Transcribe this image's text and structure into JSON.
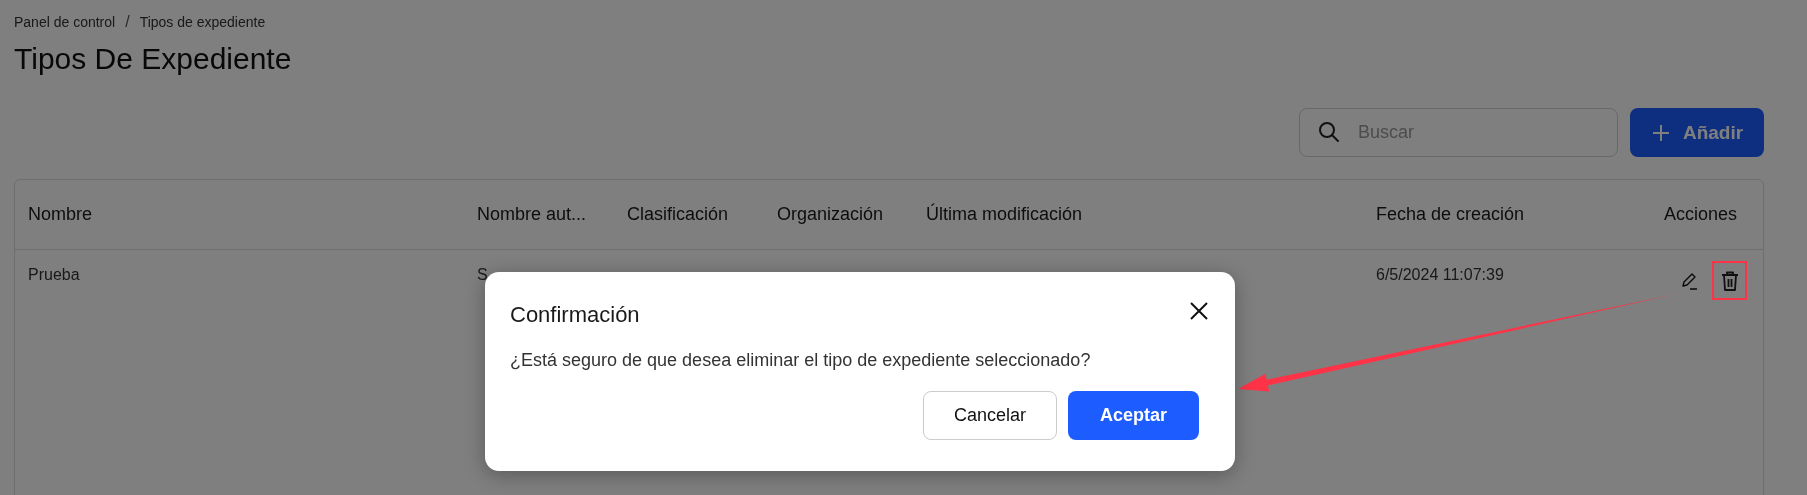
{
  "breadcrumb": {
    "items": [
      {
        "label": "Panel de control"
      },
      {
        "label": "Tipos de expediente"
      }
    ],
    "separator": "/"
  },
  "title": "Tipos De Expediente",
  "search": {
    "placeholder": "Buscar"
  },
  "add_button": {
    "label": "Añadir"
  },
  "table": {
    "columns": [
      "Nombre",
      "Nombre aut...",
      "Clasificación",
      "Organización",
      "Última modificación",
      "Fecha de creación",
      "Acciones"
    ],
    "rows": [
      {
        "nombre": "Prueba",
        "nombre_aut": "S",
        "fecha_de_creacion": "6/5/2024 11:07:39",
        "actions": [
          {
            "kind": "edit",
            "highlighted": false
          },
          {
            "kind": "delete",
            "highlighted": true
          }
        ]
      }
    ]
  },
  "dialog": {
    "title": "Confirmación",
    "message": "¿Está seguro de que desea eliminar el tipo de expediente seleccionado?",
    "buttons": [
      {
        "label": "Cancelar",
        "kind": "secondary"
      },
      {
        "label": "Aceptar",
        "kind": "primary"
      }
    ]
  }
}
